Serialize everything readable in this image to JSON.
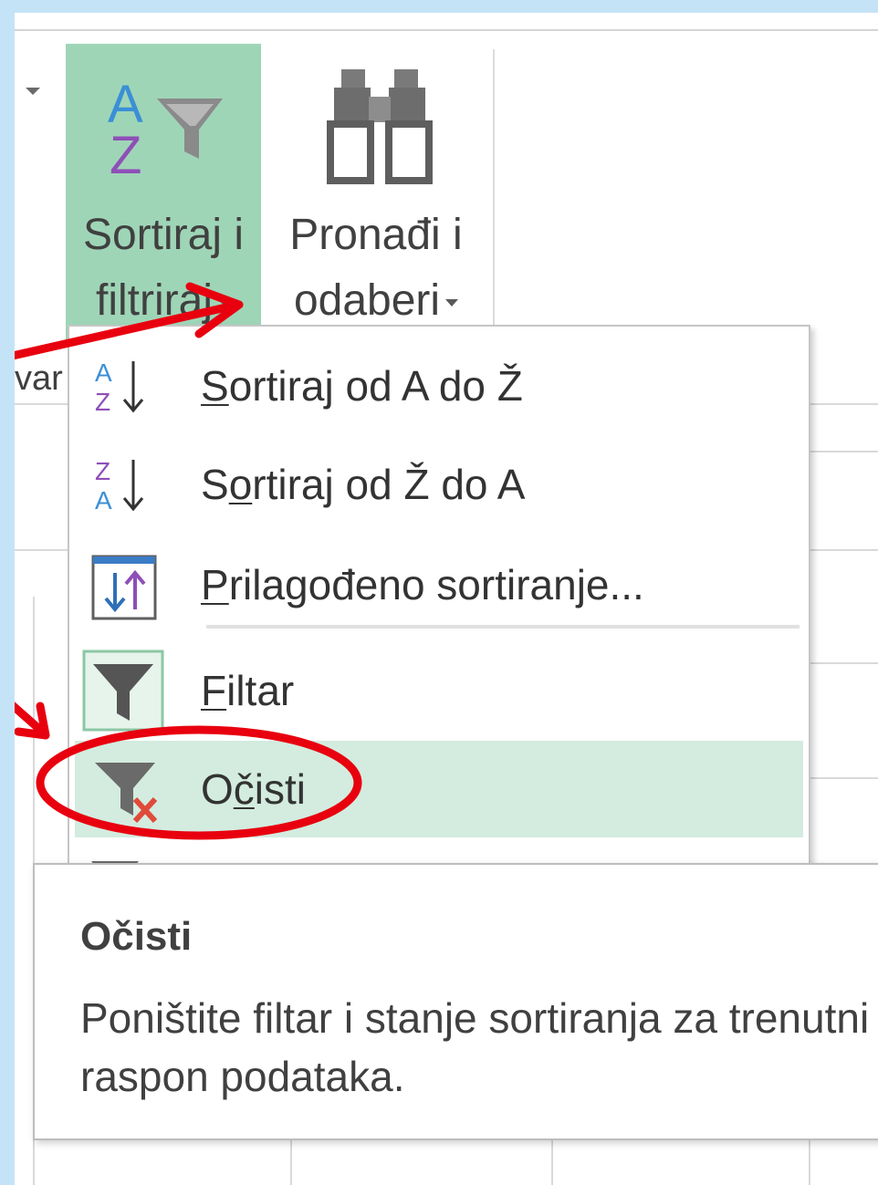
{
  "ribbon": {
    "sort_filter": {
      "line1": "Sortiraj i",
      "line2": "filtriraj"
    },
    "find_select": {
      "line1": "Pronađi i",
      "line2": "odaberi"
    },
    "partial_left_text": "var"
  },
  "menu": {
    "items": [
      {
        "prefix": "",
        "hotkey": "S",
        "rest": "ortiraj od A do Ž",
        "icon": "sort-a-to-z-icon"
      },
      {
        "prefix": "S",
        "hotkey": "o",
        "rest": "rtiraj od Ž do A",
        "icon": "sort-z-to-a-icon"
      },
      {
        "prefix": "",
        "hotkey": "P",
        "rest": "rilagođeno sortiranje...",
        "icon": "custom-sort-icon"
      },
      {
        "prefix": "",
        "hotkey": "F",
        "rest": "iltar",
        "icon": "filter-icon"
      },
      {
        "prefix": "O",
        "hotkey": "č",
        "rest": "isti",
        "icon": "clear-filter-icon"
      }
    ]
  },
  "tooltip": {
    "title": "Očisti",
    "description": "Poništite filtar i stanje sortiranja za trenutni raspon podataka."
  },
  "colors": {
    "highlight_green": "#9fd5b7",
    "menu_hover": "#d3ecdf",
    "annotation_red": "#e8000f",
    "frame_blue": "#c5e3f7"
  }
}
